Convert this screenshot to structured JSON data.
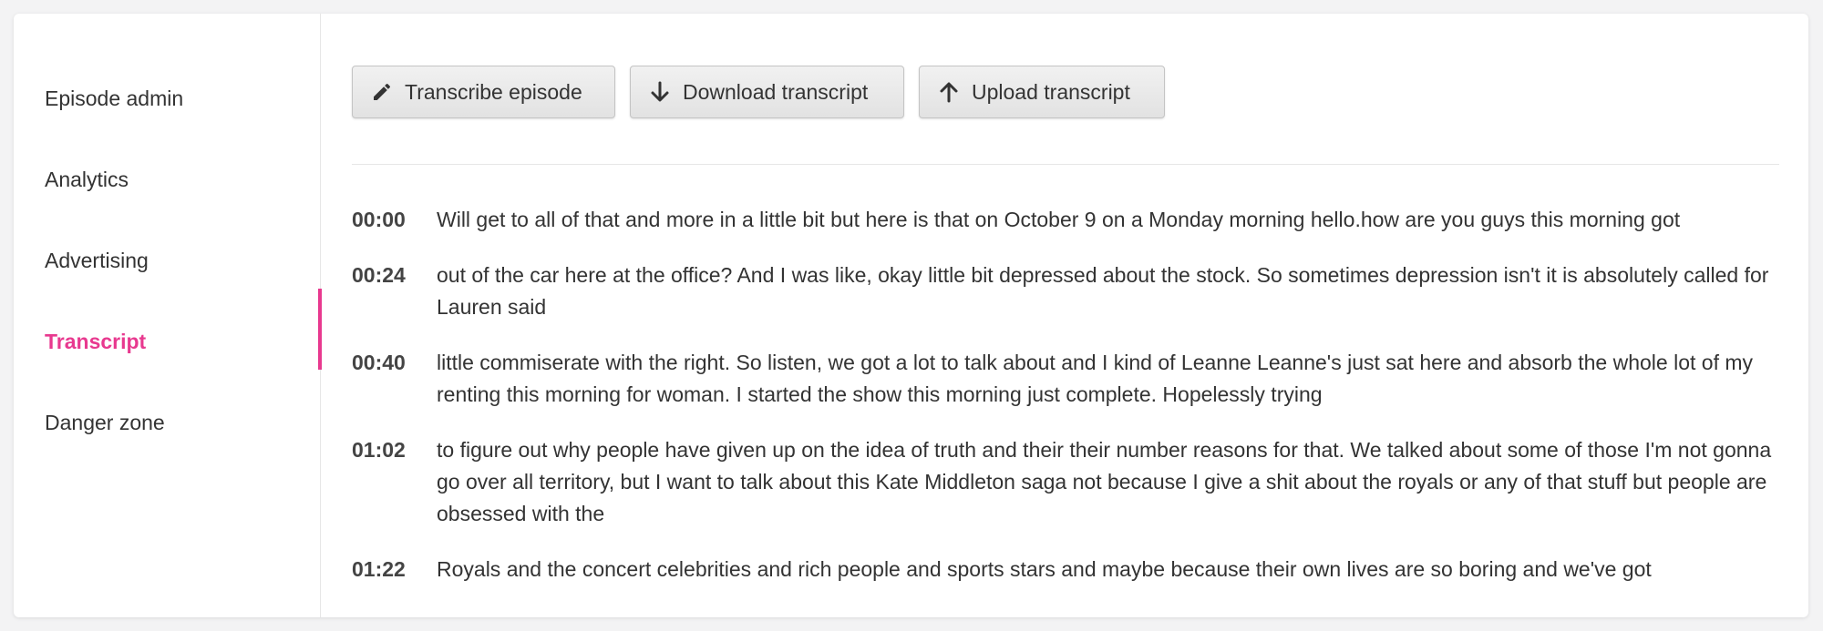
{
  "sidebar": {
    "items": [
      {
        "label": "Episode admin"
      },
      {
        "label": "Analytics"
      },
      {
        "label": "Advertising"
      },
      {
        "label": "Transcript"
      },
      {
        "label": "Danger zone"
      }
    ],
    "active_item": "Transcript"
  },
  "toolbar": {
    "transcribe_label": "Transcribe episode",
    "download_label": "Download transcript",
    "upload_label": "Upload transcript"
  },
  "transcript": {
    "segments": [
      {
        "time": "00:00",
        "text": "Will get to all of that and more in a little bit but here is that on October 9 on a Monday morning hello.how are you guys this morning got"
      },
      {
        "time": "00:24",
        "text": "out of the car here at the office? And I was like, okay little bit depressed about the stock. So sometimes depression isn't it is absolutely called for Lauren said"
      },
      {
        "time": "00:40",
        "text": "little commiserate with the right. So listen, we got a lot to talk about and I kind of Leanne Leanne's just sat here and absorb the whole lot of my renting this morning for woman. I started the show this morning just complete. Hopelessly trying"
      },
      {
        "time": "01:02",
        "text": "to figure out why people have given up on the idea of truth and their their number reasons for that. We talked about some of those I'm not gonna go over all territory, but I want to talk about this Kate Middleton saga not because I give a shit about the royals or any of that stuff but people are obsessed with the"
      },
      {
        "time": "01:22",
        "text": "Royals and the concert celebrities and rich people and sports stars and maybe because their own lives are so boring and we've got"
      }
    ]
  },
  "colors": {
    "accent": "#e8398f",
    "text": "#333333",
    "divider": "#e6e6e6"
  },
  "icons": {
    "transcribe": "pencil-icon",
    "download": "arrow-down-icon",
    "upload": "arrow-up-icon"
  }
}
